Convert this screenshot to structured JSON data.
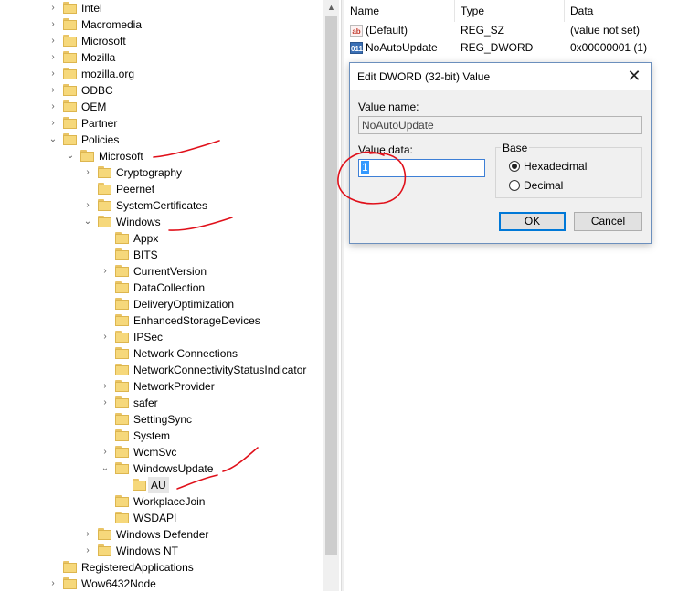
{
  "tree": {
    "items": [
      {
        "label": "Intel",
        "level": 0,
        "expander": "collapsed"
      },
      {
        "label": "Macromedia",
        "level": 0,
        "expander": "collapsed"
      },
      {
        "label": "Microsoft",
        "level": 0,
        "expander": "collapsed"
      },
      {
        "label": "Mozilla",
        "level": 0,
        "expander": "collapsed"
      },
      {
        "label": "mozilla.org",
        "level": 0,
        "expander": "collapsed"
      },
      {
        "label": "ODBC",
        "level": 0,
        "expander": "collapsed"
      },
      {
        "label": "OEM",
        "level": 0,
        "expander": "collapsed"
      },
      {
        "label": "Partner",
        "level": 0,
        "expander": "collapsed"
      },
      {
        "label": "Policies",
        "level": 0,
        "expander": "expanded"
      },
      {
        "label": "Microsoft",
        "level": 1,
        "expander": "expanded"
      },
      {
        "label": "Cryptography",
        "level": 2,
        "expander": "collapsed"
      },
      {
        "label": "Peernet",
        "level": 2,
        "expander": "none"
      },
      {
        "label": "SystemCertificates",
        "level": 2,
        "expander": "collapsed"
      },
      {
        "label": "Windows",
        "level": 2,
        "expander": "expanded"
      },
      {
        "label": "Appx",
        "level": 3,
        "expander": "none"
      },
      {
        "label": "BITS",
        "level": 3,
        "expander": "none"
      },
      {
        "label": "CurrentVersion",
        "level": 3,
        "expander": "collapsed"
      },
      {
        "label": "DataCollection",
        "level": 3,
        "expander": "none"
      },
      {
        "label": "DeliveryOptimization",
        "level": 3,
        "expander": "none"
      },
      {
        "label": "EnhancedStorageDevices",
        "level": 3,
        "expander": "none"
      },
      {
        "label": "IPSec",
        "level": 3,
        "expander": "collapsed"
      },
      {
        "label": "Network Connections",
        "level": 3,
        "expander": "none"
      },
      {
        "label": "NetworkConnectivityStatusIndicator",
        "level": 3,
        "expander": "none"
      },
      {
        "label": "NetworkProvider",
        "level": 3,
        "expander": "collapsed"
      },
      {
        "label": "safer",
        "level": 3,
        "expander": "collapsed"
      },
      {
        "label": "SettingSync",
        "level": 3,
        "expander": "none"
      },
      {
        "label": "System",
        "level": 3,
        "expander": "none"
      },
      {
        "label": "WcmSvc",
        "level": 3,
        "expander": "collapsed"
      },
      {
        "label": "WindowsUpdate",
        "level": 3,
        "expander": "expanded"
      },
      {
        "label": "AU",
        "level": 4,
        "expander": "none",
        "selected": true
      },
      {
        "label": "WorkplaceJoin",
        "level": 3,
        "expander": "none"
      },
      {
        "label": "WSDAPI",
        "level": 3,
        "expander": "none"
      },
      {
        "label": "Windows Defender",
        "level": 2,
        "expander": "collapsed"
      },
      {
        "label": "Windows NT",
        "level": 2,
        "expander": "collapsed"
      },
      {
        "label": "RegisteredApplications",
        "level": 0,
        "expander": "none"
      },
      {
        "label": "Wow6432Node",
        "level": 0,
        "expander": "collapsed"
      }
    ]
  },
  "list": {
    "headers": {
      "name": "Name",
      "type": "Type",
      "data": "Data"
    },
    "rows": [
      {
        "icon": "string-value-icon",
        "icon_text": "ab",
        "name": "(Default)",
        "type": "REG_SZ",
        "data": "(value not set)"
      },
      {
        "icon": "dword-value-icon",
        "icon_text": "011",
        "name": "NoAutoUpdate",
        "type": "REG_DWORD",
        "data": "0x00000001 (1)"
      }
    ]
  },
  "dialog": {
    "title": "Edit DWORD (32-bit) Value",
    "close_glyph": "✕",
    "value_name_label": "Value name:",
    "value_name": "NoAutoUpdate",
    "value_data_label": "Value data:",
    "value_data": "1",
    "base_label": "Base",
    "radio_hex": "Hexadecimal",
    "radio_dec": "Decimal",
    "selected_base": "hexadecimal",
    "ok": "OK",
    "cancel": "Cancel"
  },
  "annotations": {
    "color": "#e0101a"
  }
}
